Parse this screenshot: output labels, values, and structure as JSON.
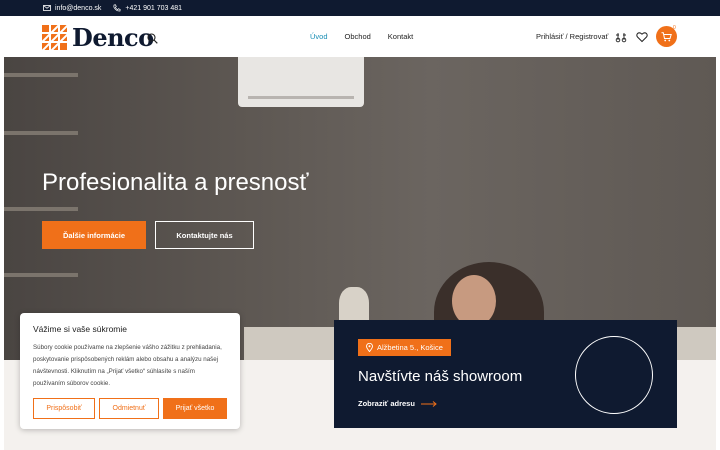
{
  "topbar": {
    "email": "info@denco.sk",
    "phone": "+421 901 703 481"
  },
  "header": {
    "logo_text": "Denco",
    "nav": [
      "Úvod",
      "Obchod",
      "Kontakt"
    ],
    "account": "Prihlásiť / Registrovať",
    "cart_count": "0",
    "icons": [
      "search-icon",
      "compare-icon",
      "heart-icon",
      "cart-icon"
    ]
  },
  "hero": {
    "title": "Profesionalita a presnosť",
    "primary_button": "Ďalšie informácie",
    "secondary_button": "Kontaktujte nás"
  },
  "showroom": {
    "address": "Alžbetina 5., Košice",
    "title": "Navštívte náš showroom",
    "link": "Zobraziť adresu"
  },
  "cookie": {
    "title": "Vážime si vaše súkromie",
    "text": "Súbory cookie používame na zlepšenie vášho zážitku z prehliadania, poskytovanie prispôsobených reklám alebo obsahu a analýzu našej návštevnosti. Kliknutím na „Prijať všetko“ súhlasíte s naším používaním súborov cookie.",
    "buttons": [
      "Prispôsobiť",
      "Odmietnuť",
      "Prijať všetko"
    ]
  },
  "colors": {
    "accent": "#f07019",
    "navy": "#0f1a30",
    "active_nav": "#1a8fb5"
  }
}
